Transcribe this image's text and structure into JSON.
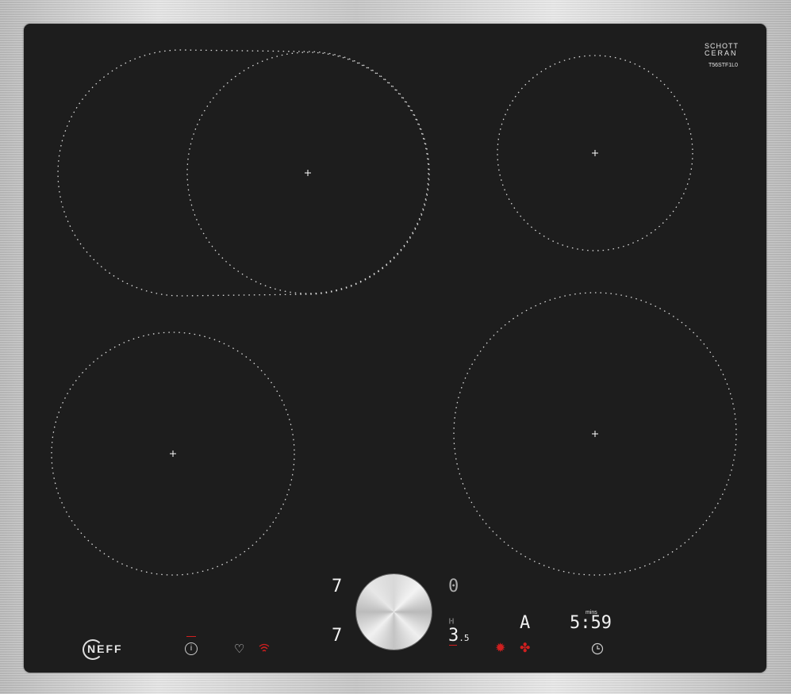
{
  "brand": "NEFF",
  "glass_brand": {
    "line1": "SCHOTT",
    "line2": "CERAN"
  },
  "model": "T56STF1L0",
  "displays": {
    "left_top": "7",
    "left_bottom": "7",
    "right_top": "0",
    "power_level": "3",
    "power_level_decimal": ".5",
    "mode": "A",
    "timer": "5:59",
    "timer_unit": "mins"
  },
  "icons": [
    "info-icon",
    "heart-icon",
    "wifi-icon",
    "power-boost-icon",
    "fan-icon",
    "timer-clock-icon"
  ],
  "colors": {
    "glass": "#1d1d1d",
    "accent_red": "#d01f1f",
    "dots": "#ffffff"
  }
}
